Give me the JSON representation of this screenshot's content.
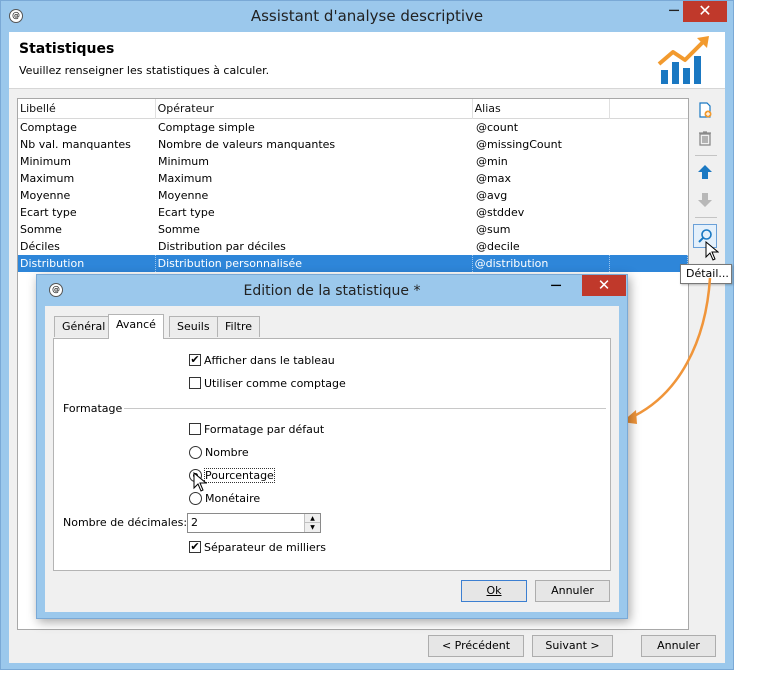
{
  "window": {
    "title": "Assistant d'analyse descriptive",
    "minimize": "─",
    "close": "✕"
  },
  "header": {
    "title": "Statistiques",
    "subtitle": "Veuillez renseigner les statistiques à calculer."
  },
  "table": {
    "columns": [
      "Libellé",
      "Opérateur",
      "Alias",
      ""
    ],
    "rows": [
      {
        "label": "Comptage",
        "operator": "Comptage simple",
        "alias": "@count"
      },
      {
        "label": "Nb val. manquantes",
        "operator": "Nombre de valeurs manquantes",
        "alias": "@missingCount"
      },
      {
        "label": "Minimum",
        "operator": "Minimum",
        "alias": "@min"
      },
      {
        "label": "Maximum",
        "operator": "Maximum",
        "alias": "@max"
      },
      {
        "label": "Moyenne",
        "operator": "Moyenne",
        "alias": "@avg"
      },
      {
        "label": "Ecart type",
        "operator": "Ecart type",
        "alias": "@stddev"
      },
      {
        "label": "Somme",
        "operator": "Somme",
        "alias": "@sum"
      },
      {
        "label": "Déciles",
        "operator": "Distribution par déciles",
        "alias": "@decile"
      },
      {
        "label": "Distribution",
        "operator": "Distribution personnalisée",
        "alias": "@distribution"
      }
    ],
    "selected_index": 8
  },
  "toolbar": {
    "tooltip": "Détail..."
  },
  "footer": {
    "previous": "< Précédent",
    "next": "Suivant >",
    "cancel": "Annuler"
  },
  "dialog": {
    "title": "Edition de la statistique *",
    "minimize": "─",
    "close": "✕",
    "tabs": [
      "Général",
      "Avancé",
      "Seuils",
      "Filtre"
    ],
    "active_tab": "Avancé",
    "show_in_table": {
      "label": "Afficher dans le tableau",
      "checked": true
    },
    "use_as_count": {
      "label": "Utiliser comme comptage",
      "checked": false
    },
    "group_label": "Formatage",
    "default_format": {
      "label": "Formatage par défaut",
      "checked": false
    },
    "format_options": [
      {
        "label": "Nombre",
        "selected": false
      },
      {
        "label": "Pourcentage",
        "selected": true
      },
      {
        "label": "Monétaire",
        "selected": false
      }
    ],
    "decimals_label": "Nombre de décimales:",
    "decimals_value": "2",
    "thousands_sep": {
      "label": "Séparateur de milliers",
      "checked": true
    },
    "ok": "Ok",
    "cancel": "Annuler"
  },
  "colors": {
    "selection": "#2e86d9",
    "titlebar": "#9bc8ec",
    "close": "#c0392b",
    "annotation": "#f0953a"
  }
}
